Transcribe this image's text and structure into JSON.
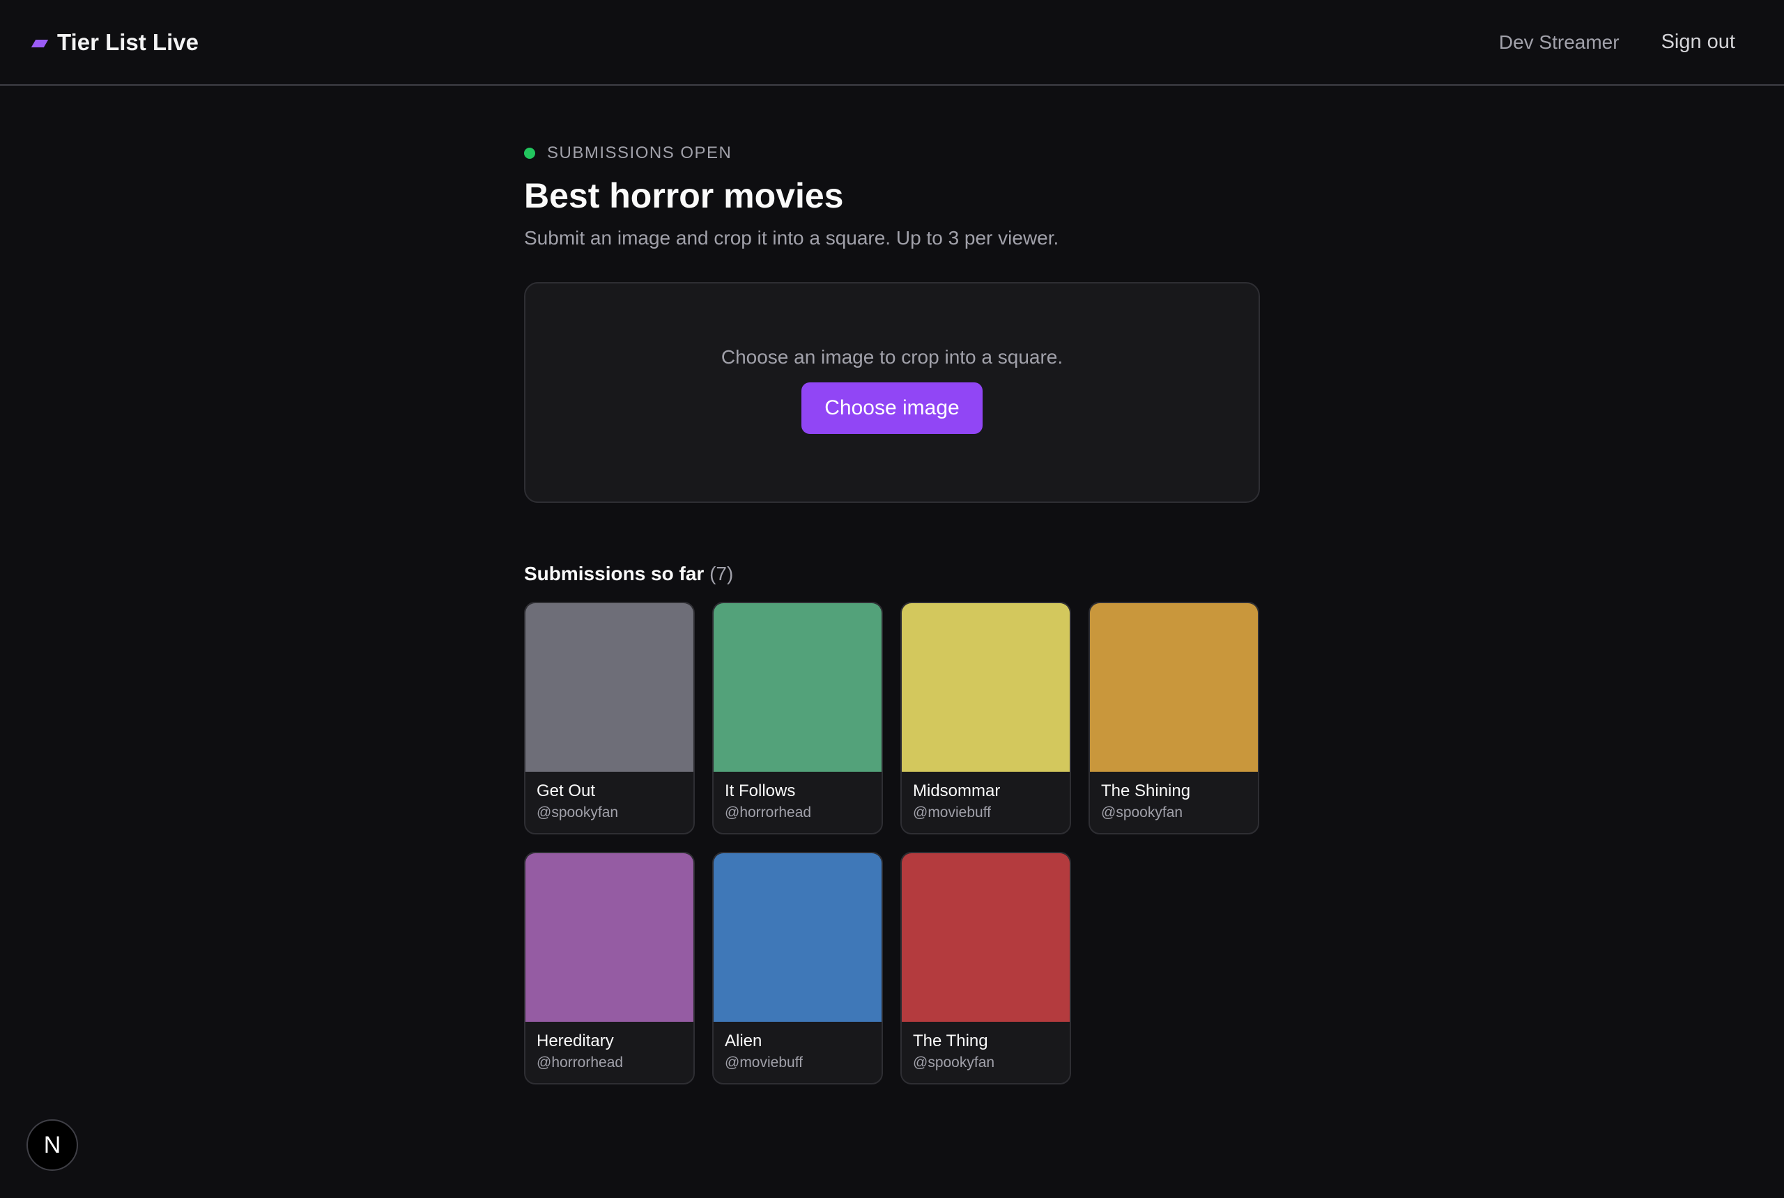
{
  "header": {
    "brand": "Tier List Live",
    "user": "Dev Streamer",
    "sign_out": "Sign out",
    "accent": "#9b5cf6"
  },
  "status": {
    "label": "SUBMISSIONS OPEN",
    "color": "#22c55e"
  },
  "page": {
    "title": "Best horror movies",
    "subtitle": "Submit an image and crop it into a square. Up to 3 per viewer."
  },
  "upload": {
    "hint": "Choose an image to crop into a square.",
    "button_label": "Choose image",
    "button_color": "#9146f5"
  },
  "submissions": {
    "heading": "Submissions so far",
    "count": "(7)",
    "items": [
      {
        "title": "Get Out",
        "user": "@spookyfan",
        "color": "#6e6e78"
      },
      {
        "title": "It Follows",
        "user": "@horrorhead",
        "color": "#53a27a"
      },
      {
        "title": "Midsommar",
        "user": "@moviebuff",
        "color": "#d3c85d"
      },
      {
        "title": "The Shining",
        "user": "@spookyfan",
        "color": "#c9973c"
      },
      {
        "title": "Hereditary",
        "user": "@horrorhead",
        "color": "#955ca3"
      },
      {
        "title": "Alien",
        "user": "@moviebuff",
        "color": "#3f78b8"
      },
      {
        "title": "The Thing",
        "user": "@spookyfan",
        "color": "#b43b3e"
      }
    ]
  },
  "badge": {
    "glyph": "N",
    "icon": "nextjs-icon"
  }
}
